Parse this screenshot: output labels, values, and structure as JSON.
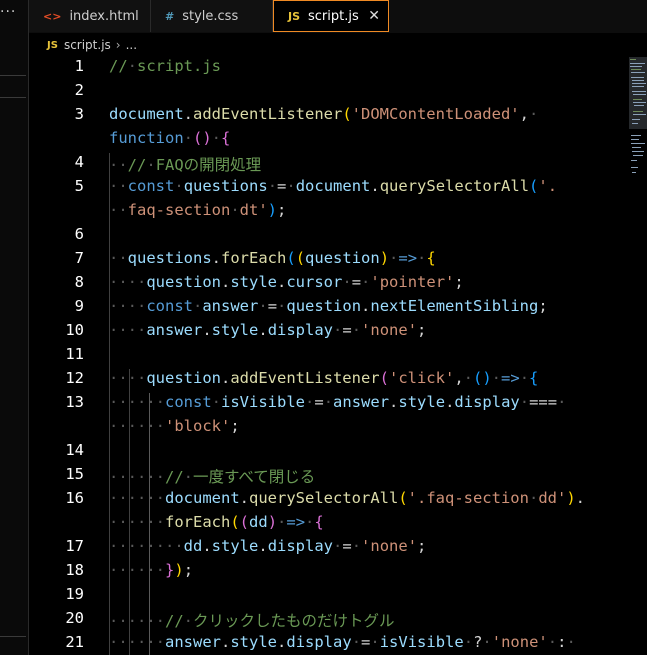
{
  "tabs": [
    {
      "icon": "<>",
      "label": "index.html",
      "icon_color": "#e44d26"
    },
    {
      "icon": "#",
      "label": "style.css",
      "icon_color": "#519aba"
    },
    {
      "icon": "JS",
      "label": "script.js",
      "icon_color": "#e8c33a",
      "active": true
    }
  ],
  "more_icon": "···",
  "close_glyph": "✕",
  "breadcrumb": {
    "icon": "JS",
    "file": "script.js",
    "sep": "›",
    "more": "..."
  },
  "lines": [
    {
      "n": "1",
      "html": "<span class=\"cm\">//<span class=\"dot\">·</span>script.js</span>"
    },
    {
      "n": "2",
      "html": ""
    },
    {
      "n": "3",
      "html": "<span class=\"vr\">document</span>.<span class=\"fn\">addEventListener</span><span class=\"b1\">(</span><span class=\"st\">'DOMContentLoaded'</span>,<span class=\"dot\">·</span>"
    },
    {
      "n": "",
      "html": "<span class=\"kw\">function</span><span class=\"dot\">·</span><span class=\"b2\">()</span><span class=\"dot\">·</span><span class=\"b2\">{</span>"
    },
    {
      "n": "4",
      "html": "<span class=\"dot\">··</span><span class=\"cm\">//<span class=\"dot\">·</span>FAQの開閉処理</span>"
    },
    {
      "n": "5",
      "html": "<span class=\"dot\">··</span><span class=\"kw\">const</span><span class=\"dot\">·</span><span class=\"vr\">questions</span><span class=\"dot\">·</span>=<span class=\"dot\">·</span><span class=\"vr\">document</span>.<span class=\"fn\">querySelectorAll</span><span class=\"b3\">(</span><span class=\"st\">'.</span>"
    },
    {
      "n": "",
      "html": "<span class=\"dot\">··</span><span class=\"st\">faq-section<span class=\"dot\">·</span>dt'</span><span class=\"b3\">)</span>;"
    },
    {
      "n": "6",
      "html": ""
    },
    {
      "n": "7",
      "html": "<span class=\"dot\">··</span><span class=\"vr\">questions</span>.<span class=\"fn\">forEach</span><span class=\"b3\">(</span><span class=\"b1\">(</span><span class=\"vr\">question</span><span class=\"b1\">)</span><span class=\"dot\">·</span><span class=\"kw\">=&gt;</span><span class=\"dot\">·</span><span class=\"b1\">{</span>"
    },
    {
      "n": "8",
      "html": "<span class=\"dot\">····</span><span class=\"vr\">question</span>.<span class=\"vr\">style</span>.<span class=\"vr\">cursor</span><span class=\"dot\">·</span>=<span class=\"dot\">·</span><span class=\"st\">'pointer'</span>;"
    },
    {
      "n": "9",
      "html": "<span class=\"dot\">····</span><span class=\"kw\">const</span><span class=\"dot\">·</span><span class=\"vr\">answer</span><span class=\"dot\">·</span>=<span class=\"dot\">·</span><span class=\"vr\">question</span>.<span class=\"vr\">nextElementSibling</span>;"
    },
    {
      "n": "10",
      "html": "<span class=\"dot\">····</span><span class=\"vr\">answer</span>.<span class=\"vr\">style</span>.<span class=\"vr\">display</span><span class=\"dot\">·</span>=<span class=\"dot\">·</span><span class=\"st\">'none'</span>;"
    },
    {
      "n": "11",
      "html": ""
    },
    {
      "n": "12",
      "html": "<span class=\"dot\">····</span><span class=\"vr\">question</span>.<span class=\"fn\">addEventListener</span><span class=\"b2\">(</span><span class=\"st\">'click'</span>,<span class=\"dot\">·</span><span class=\"b3\">()</span><span class=\"dot\">·</span><span class=\"kw\">=&gt;</span><span class=\"dot\">·</span><span class=\"b3\">{</span>"
    },
    {
      "n": "13",
      "html": "<span class=\"dot\">······</span><span class=\"kw\">const</span><span class=\"dot\">·</span><span class=\"vr\">isVisible</span><span class=\"dot\">·</span>=<span class=\"dot\">·</span><span class=\"vr\">answer</span>.<span class=\"vr\">style</span>.<span class=\"vr\">display</span><span class=\"dot\">·</span>===<span class=\"dot\">·</span>"
    },
    {
      "n": "",
      "html": "<span class=\"dot\">······</span><span class=\"st\">'block'</span>;"
    },
    {
      "n": "14",
      "html": ""
    },
    {
      "n": "15",
      "html": "<span class=\"dot\">······</span><span class=\"cm\">//<span class=\"dot\">·</span>一度すべて閉じる</span>"
    },
    {
      "n": "16",
      "html": "<span class=\"dot\">······</span><span class=\"vr\">document</span>.<span class=\"fn\">querySelectorAll</span><span class=\"b1\">(</span><span class=\"st\">'.faq-section<span class=\"dot\">·</span>dd'</span><span class=\"b1\">)</span>."
    },
    {
      "n": "",
      "html": "<span class=\"dot\">······</span><span class=\"fn\">forEach</span><span class=\"b1\">(</span><span class=\"b2\">(</span><span class=\"vr\">dd</span><span class=\"b2\">)</span><span class=\"dot\">·</span><span class=\"kw\">=&gt;</span><span class=\"dot\">·</span><span class=\"b2\">{</span>"
    },
    {
      "n": "17",
      "html": "<span class=\"dot\">········</span><span class=\"vr\">dd</span>.<span class=\"vr\">style</span>.<span class=\"vr\">display</span><span class=\"dot\">·</span>=<span class=\"dot\">·</span><span class=\"st\">'none'</span>;"
    },
    {
      "n": "18",
      "html": "<span class=\"dot\">······</span><span class=\"b2\">}</span><span class=\"b1\">)</span>;"
    },
    {
      "n": "19",
      "html": ""
    },
    {
      "n": "20",
      "html": "<span class=\"dot\">······</span><span class=\"cm\">//<span class=\"dot\">·</span>クリックしたものだけトグル</span>"
    },
    {
      "n": "21",
      "html": "<span class=\"dot\">······</span><span class=\"vr\">answer</span>.<span class=\"vr\">style</span>.<span class=\"vr\">display</span><span class=\"dot\">·</span>=<span class=\"dot\">·</span><span class=\"vr\">isVisible</span><span class=\"dot\">·</span>?<span class=\"dot\">·</span><span class=\"st\">'none'</span><span class=\"dot\">·</span>:<span class=\"dot\">·</span>"
    }
  ]
}
